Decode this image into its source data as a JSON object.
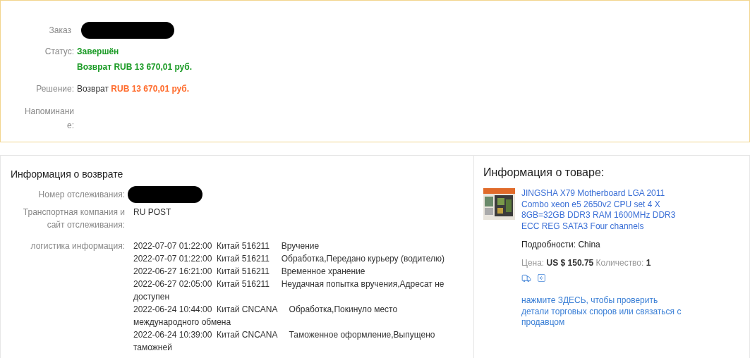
{
  "order": {
    "order_label": "Заказ",
    "status_label": "Статус:",
    "status": "Завершён",
    "status_refund": "Возврат RUB 13 670,01 руб.",
    "decision_label": "Решение:",
    "decision_prefix": "Возврат",
    "decision_amount": "RUB 13 670,01 руб.",
    "reminder_label": "Напоминание:"
  },
  "return_info": {
    "title": "Информация о возврате",
    "tracking_label": "Номер отслеживания:",
    "carrier_label": "Транспортная компания и сайт отслеживания:",
    "carrier": "RU POST",
    "logistics_label": "логистика информация:",
    "events": [
      {
        "date": "2022-07-07 01:22:00",
        "place": "Китай 516211",
        "event": "Вручение"
      },
      {
        "date": "2022-07-07 01:22:00",
        "place": "Китай 516211",
        "event": "Обработка,Передано курьеру (водителю)"
      },
      {
        "date": "2022-06-27 16:21:00",
        "place": "Китай 516211",
        "event": "Временное хранение"
      },
      {
        "date": "2022-06-27 02:05:00",
        "place": "Китай 516211",
        "event": "Неудачная попытка вручения,Адресат не доступен"
      },
      {
        "date": "2022-06-24 10:44:00",
        "place": "Китай CNCANA",
        "event": "Обработка,Покинуло место международного обмена"
      },
      {
        "date": "2022-06-24 10:39:00",
        "place": "Китай CNCANA",
        "event": "Таможенное оформление,Выпущено таможней"
      }
    ]
  },
  "product": {
    "title": "Информация о товаре:",
    "name": "JINGSHA X79 Motherboard LGA 2011 Combo xeon e5 2650v2 CPU set 4 X 8GB=32GB DDR3 RAM 1600MHz DDR3 ECC REG SATA3 Four channels",
    "details_label": "Подробности:",
    "details": "China",
    "price_label": "Цена:",
    "price": "US $ 150.75",
    "qty_label": "Количество:",
    "qty": "1",
    "dispute_link": "нажмите ЗДЕСЬ, чтобы проверить детали торговых споров или связаться с продавцом"
  }
}
